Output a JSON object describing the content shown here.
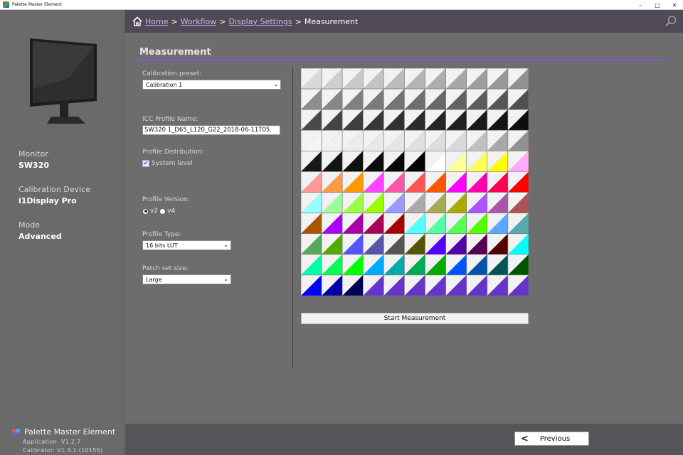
{
  "window": {
    "title": "Palette Master Element",
    "controls": {
      "minimize": "–",
      "maximize": "□",
      "close": "✕"
    }
  },
  "sidebar": {
    "monitor_label": "Monitor",
    "monitor_value": "SW320",
    "device_label": "Calibration Device",
    "device_value": "i1Display Pro",
    "mode_label": "Mode",
    "mode_value": "Advanced",
    "brand_name": "Palette Master Element",
    "app_version": "Application: V1.2.7",
    "calibrator_version": "Calibrator: V1.3.1 (10155)"
  },
  "breadcrumb": {
    "items": [
      "Home",
      "Workflow",
      "Display Settings"
    ],
    "separator": ">",
    "current": "Measurement"
  },
  "main": {
    "title": "Measurement",
    "calibration_preset": {
      "label": "Calibration preset:",
      "value": "Calibration 1"
    },
    "icc_profile": {
      "label": "ICC Profile Name:",
      "value": "SW320 1_D65_L120_G22_2018-06-11T05."
    },
    "profile_distribution": {
      "label": "Profile Distribution:",
      "option": "System level",
      "checked": true
    },
    "profile_version": {
      "label": "Profile Version:",
      "options": [
        "v2",
        "v4"
      ],
      "selected": "v2"
    },
    "profile_type": {
      "label": "Profile Type:",
      "value": "16 bits LUT"
    },
    "patch_set": {
      "label": "Patch set size:",
      "value": "Large"
    },
    "start_button": "Start Measurement"
  },
  "footer": {
    "previous": "Previous"
  },
  "colors": {
    "accent": "#8d53d6",
    "header_bg": "#4f4a55",
    "panel_bg": "#6d6d6d",
    "link": "#c8b3ee"
  },
  "patches": {
    "columns": 11,
    "rows": 11,
    "cells": [
      [
        "#d8d8d8",
        "#cfcfcf",
        "#c9c9c9",
        "#c2c2c2",
        "#bbbbbb",
        "#b4b4b4",
        "#adadad",
        "#a6a6a6",
        "#9f9f9f",
        "#989898",
        "#919191"
      ],
      [
        "#8c8c8c",
        "#868686",
        "#808080",
        "#7a7a7a",
        "#747474",
        "#6e6e6e",
        "#686868",
        "#626262",
        "#5c5c5c",
        "#565656",
        "#505050"
      ],
      [
        "#4a4a4a",
        "#444444",
        "#3e3e3e",
        "#383838",
        "#323232",
        "#2c2c2c",
        "#262626",
        "#202020",
        "#1a1a1a",
        "#141414",
        "#0e0e0e"
      ],
      [
        "#f4f4f4",
        "#f0f0f0",
        "#ececec",
        "#e8e8e8",
        "#e4e4e4",
        "#e0e0e0",
        "#dcdcdc",
        "#d8d8d8",
        "#c0c0c0",
        "#a8a8a8",
        "#909090"
      ],
      [
        "#181818",
        "#141414",
        "#101010",
        "#0c0c0c",
        "#080808",
        "#040404",
        "#ffffff",
        "#ffff99",
        "#ffff55",
        "#ffff00",
        "#ffaaff"
      ],
      [
        "#ff9999",
        "#ff9944",
        "#ff9900",
        "#ff44ff",
        "#ff55aa",
        "#ff5555",
        "#ff5500",
        "#ff00ff",
        "#ff00aa",
        "#ff0055",
        "#ff0000"
      ],
      [
        "#99ffff",
        "#99ff99",
        "#99ff44",
        "#99ff00",
        "#9999ff",
        "#aaaaaa",
        "#aaaa55",
        "#aaaa00",
        "#aa55ff",
        "#aa55aa",
        "#aa5555"
      ],
      [
        "#aa5500",
        "#aa00ff",
        "#aa00aa",
        "#aa0055",
        "#aa0000",
        "#55ffff",
        "#55ffaa",
        "#55ff55",
        "#55ff00",
        "#55aaff",
        "#55aaaa"
      ],
      [
        "#55aa55",
        "#55aa00",
        "#5555ff",
        "#5555aa",
        "#555555",
        "#555500",
        "#5500ff",
        "#5500aa",
        "#550055",
        "#550000",
        "#00ffff"
      ],
      [
        "#00ffaa",
        "#00ff55",
        "#00ff00",
        "#00aaff",
        "#00aaaa",
        "#00aa55",
        "#00aa00",
        "#0055ff",
        "#0055aa",
        "#005555",
        "#005500"
      ],
      [
        "#0000ff",
        "#0000aa",
        "#000055",
        "#6633cc",
        "#6633cc",
        "#6633cc",
        "#6633cc",
        "#6633cc",
        "#6633cc",
        "#6633cc",
        "#6633cc"
      ]
    ]
  }
}
